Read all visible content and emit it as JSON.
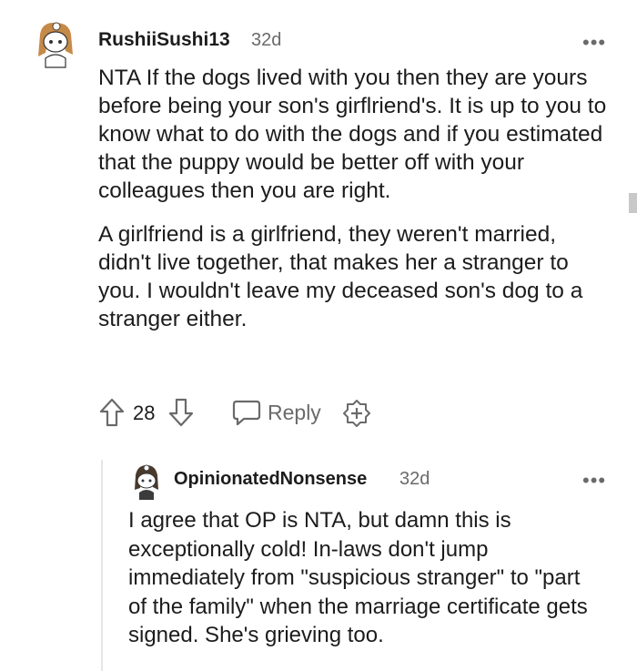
{
  "comments": [
    {
      "username": "RushiiSushi13",
      "age": "32d",
      "more": "•••",
      "paragraphs": [
        "NTA If the dogs lived with you then they are yours before being your son's girflriend's. It is up to you to know what to do with the dogs and if you estimated that the puppy would be better off with your colleagues then you are right.",
        "A girlfriend is a girlfriend, they weren't married, didn't live together, that makes her a stranger to you. I wouldn't leave my deceased son's dog to a stranger either."
      ],
      "score": "28",
      "reply_label": "Reply",
      "icons": [
        "upvote-icon",
        "downvote-icon",
        "reply-bubble-icon",
        "award-icon"
      ]
    },
    {
      "username": "OpinionatedNonsense",
      "age": "32d",
      "more": "•••",
      "paragraphs": [
        "I agree that OP is NTA, but damn this is exceptionally cold! In-laws don't jump immediately from \"suspicious stranger\" to \"part of the family\" when the marriage certificate gets signed. She's grieving too."
      ]
    }
  ],
  "colors": {
    "text": "#1c1c1c",
    "meta": "#6a6a6a",
    "icon": "#6a6a6a"
  }
}
